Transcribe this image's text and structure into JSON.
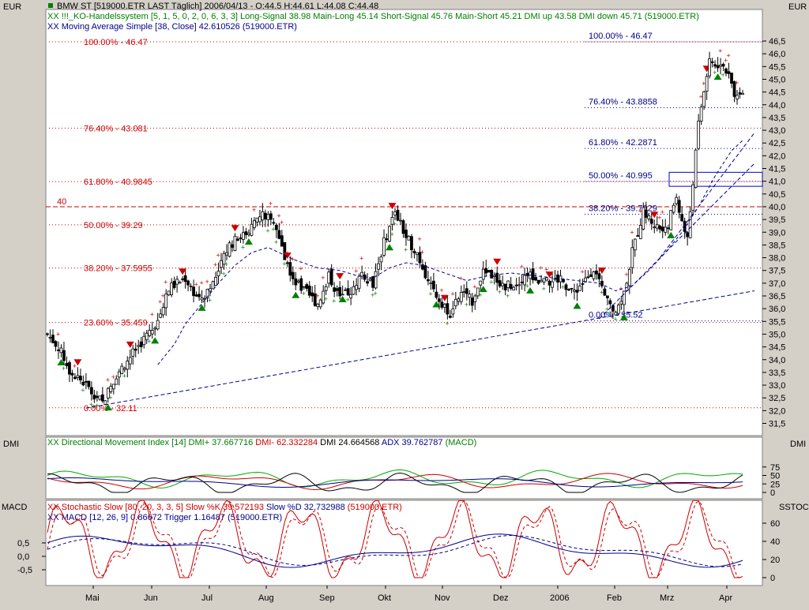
{
  "currency_left": "EUR",
  "currency_right": "EUR",
  "header": {
    "line1": "BMW ST [519000.ETR LAST Täglich] 2006/04/13 - O:44.5 H:44.61 L:44.08 C:44.48",
    "line2": "XX !!!_KO-Handelssystem [5, 1, 5, 0, 2, 0, 6, 3, 3] Long-Signal 38.98 Main-Long 45.14 Short-Signal 45.76 Main-Short 45.21 DMI up 43.58 DMI down 45.71 (519000.ETR)",
    "line3": "XX Moving Average Simple [38, Close] 42.610526 (519000.ETR)"
  },
  "price_axis_labels": [
    "46,5",
    "46,0",
    "45,5",
    "45,0",
    "44,5",
    "44,0",
    "43,5",
    "43,0",
    "42,5",
    "42,0",
    "41,5",
    "41,0",
    "40,5",
    "40,0",
    "39,5",
    "39,0",
    "38,5",
    "38,0",
    "37,5",
    "37,0",
    "36,5",
    "36,0",
    "35,5",
    "35,0",
    "34,5",
    "34,0",
    "33,5",
    "33,0",
    "32,5",
    "32,0",
    "31,5"
  ],
  "fib_left": [
    {
      "label": "100.00% - 46.47",
      "value": 46.47
    },
    {
      "label": "76.40% - 43.081",
      "value": 43.081
    },
    {
      "label": "61.80% - 40.9845",
      "value": 40.9845
    },
    {
      "label": "50.00% - 39.29",
      "value": 39.29
    },
    {
      "label": "38.20% - 37.5955",
      "value": 37.5955
    },
    {
      "label": "23.60% - 35.459",
      "value": 35.459
    },
    {
      "label": "0.00% - 32.11",
      "value": 32.11
    }
  ],
  "fib_right": [
    {
      "label": "100.00% - 46.47",
      "value": 46.47
    },
    {
      "label": "76.40% - 43.8858",
      "value": 43.8858
    },
    {
      "label": "61.80% - 42.2871",
      "value": 42.2871
    },
    {
      "label": "50.00% - 40.995",
      "value": 40.995
    },
    {
      "label": "38.20% - 39.7029",
      "value": 39.7029
    },
    {
      "label": "0.00% - 35.52",
      "value": 35.52
    }
  ],
  "level_40_label": "40",
  "dmi_panel": {
    "left_label": "DMI",
    "right_label": "DMI",
    "legend": [
      {
        "text": "XX Directional Movement Index [14]",
        "color": "#008000"
      },
      {
        "text": "DMI+ 37.667716",
        "color": "#008000"
      },
      {
        "text": "DMI- 62.332284",
        "color": "#cc0000"
      },
      {
        "text": "DMI 24.664568",
        "color": "#000000"
      },
      {
        "text": "ADX 39.762787",
        "color": "#00008b"
      },
      {
        "text": "(MACD)",
        "color": "#008000"
      }
    ],
    "axis_labels": [
      "75",
      "50",
      "25",
      "0"
    ]
  },
  "macd_panel": {
    "left_label": "MACD",
    "right_label": "SSTOC",
    "legend1": [
      {
        "text": "XX Stochastic Slow [80, 20, 3, 3, 5]",
        "color": "#cc0000"
      },
      {
        "text": "Slow %K 39.572193",
        "color": "#cc0000"
      },
      {
        "text": "Slow %D 32.732988",
        "color": "#00008b"
      },
      {
        "text": "(519000.ETR)",
        "color": "#cc0000"
      }
    ],
    "legend2": [
      {
        "text": "XX MACD [12, 26, 9] 0.86672",
        "color": "#00008b"
      },
      {
        "text": "Trigger 1.16487",
        "color": "#00008b"
      },
      {
        "text": "(519000.ETR)",
        "color": "#00008b"
      }
    ],
    "axis_left": [
      "0,5",
      "0,0",
      "-0,5"
    ],
    "axis_right": [
      "60",
      "40",
      "20",
      "0"
    ]
  },
  "x_axis_labels": [
    "Mai",
    "Jun",
    "Jul",
    "Aug",
    "Sep",
    "Okt",
    "Nov",
    "Dez",
    "2006",
    "Feb",
    "Mrz",
    "Apr"
  ],
  "chart_data": {
    "type": "candlestick",
    "title": "BMW ST [519000.ETR LAST Täglich]",
    "yrange": [
      31.2,
      46.8
    ],
    "months": [
      "Mai",
      "Jun",
      "Jul",
      "Aug",
      "Sep",
      "Okt",
      "Nov",
      "Dez",
      "2006",
      "Feb",
      "Mrz",
      "Apr"
    ],
    "close_path": [
      [
        0,
        35.0
      ],
      [
        4,
        34.5
      ],
      [
        8,
        33.6
      ],
      [
        14,
        33.0
      ],
      [
        20,
        32.3
      ],
      [
        25,
        33.4
      ],
      [
        32,
        34.4
      ],
      [
        40,
        35.5
      ],
      [
        44,
        36.8
      ],
      [
        50,
        37.2
      ],
      [
        55,
        36.3
      ],
      [
        60,
        37.0
      ],
      [
        66,
        38.5
      ],
      [
        72,
        39.0
      ],
      [
        78,
        39.7
      ],
      [
        82,
        39.4
      ],
      [
        86,
        38.0
      ],
      [
        90,
        37.0
      ],
      [
        94,
        36.6
      ],
      [
        98,
        36.2
      ],
      [
        102,
        37.3
      ],
      [
        106,
        36.4
      ],
      [
        110,
        36.7
      ],
      [
        114,
        37.4
      ],
      [
        118,
        37.0
      ],
      [
        122,
        38.6
      ],
      [
        126,
        39.8
      ],
      [
        130,
        38.8
      ],
      [
        134,
        38.2
      ],
      [
        138,
        37.0
      ],
      [
        142,
        36.4
      ],
      [
        146,
        35.8
      ],
      [
        150,
        36.6
      ],
      [
        154,
        36.3
      ],
      [
        158,
        37.6
      ],
      [
        162,
        37.2
      ],
      [
        166,
        36.9
      ],
      [
        170,
        37.0
      ],
      [
        174,
        37.4
      ],
      [
        178,
        37.1
      ],
      [
        182,
        37.0
      ],
      [
        186,
        37.2
      ],
      [
        190,
        36.6
      ],
      [
        194,
        37.0
      ],
      [
        198,
        37.6
      ],
      [
        202,
        36.4
      ],
      [
        206,
        35.9
      ],
      [
        209,
        36.6
      ],
      [
        212,
        38.2
      ],
      [
        216,
        39.8
      ],
      [
        220,
        39.3
      ],
      [
        224,
        39.0
      ],
      [
        228,
        40.4
      ],
      [
        230,
        39.4
      ],
      [
        232,
        38.7
      ],
      [
        234,
        41.0
      ],
      [
        236,
        43.2
      ],
      [
        238,
        44.5
      ],
      [
        240,
        45.8
      ],
      [
        242,
        45.5
      ],
      [
        244,
        45.7
      ],
      [
        246,
        45.3
      ],
      [
        248,
        44.8
      ],
      [
        250,
        44.2
      ],
      [
        252,
        44.48
      ]
    ],
    "ma38_path": [
      [
        40,
        33.8
      ],
      [
        46,
        34.6
      ],
      [
        50,
        35.4
      ],
      [
        56,
        36.2
      ],
      [
        62,
        37.0
      ],
      [
        68,
        37.7
      ],
      [
        74,
        38.2
      ],
      [
        80,
        38.4
      ],
      [
        84,
        38.2
      ],
      [
        90,
        37.9
      ],
      [
        98,
        37.6
      ],
      [
        106,
        37.5
      ],
      [
        112,
        37.3
      ],
      [
        118,
        37.2
      ],
      [
        124,
        37.6
      ],
      [
        130,
        37.8
      ],
      [
        136,
        37.7
      ],
      [
        144,
        37.4
      ],
      [
        152,
        37.1
      ],
      [
        160,
        37.3
      ],
      [
        168,
        37.4
      ],
      [
        176,
        37.3
      ],
      [
        184,
        37.2
      ],
      [
        192,
        37.1
      ],
      [
        200,
        37.0
      ],
      [
        206,
        36.7
      ],
      [
        212,
        36.9
      ],
      [
        218,
        37.5
      ],
      [
        224,
        38.2
      ],
      [
        230,
        39.0
      ],
      [
        236,
        40.0
      ],
      [
        242,
        41.2
      ],
      [
        248,
        42.2
      ],
      [
        252,
        42.6
      ]
    ],
    "trendlines": [
      {
        "from": [
          14,
          32.1
        ],
        "to": [
          252,
          36.7
        ]
      },
      {
        "from": [
          200,
          35.6
        ],
        "to": [
          252,
          41.7
        ]
      },
      {
        "from": [
          222,
          38.0
        ],
        "to": [
          252,
          42.9
        ]
      }
    ],
    "resistance_band": [
      40.8,
      41.35
    ]
  }
}
